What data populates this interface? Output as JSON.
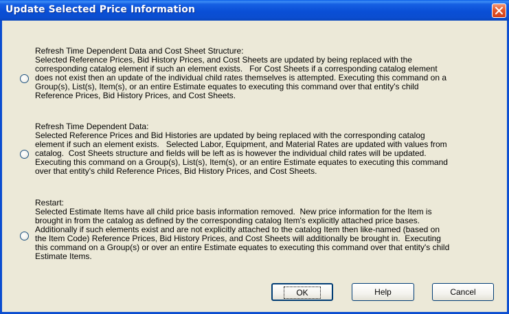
{
  "window": {
    "title": "Update Selected Price Information",
    "close_icon": "close-icon"
  },
  "options": [
    {
      "heading": "Refresh Time Dependent Data and Cost Sheet Structure:",
      "lines": [
        "Selected Reference Prices, Bid History Prices, and Cost Sheets are updated by being replaced with the",
        "corresponding catalog element if such an element exists.   For Cost Sheets if a corresponding catalog element",
        "does not exist then an update of the individual child rates themselves is attempted. Executing this command on a",
        "Group(s), List(s), Item(s), or an entire Estimate equates to executing this command over that entity's child",
        "Reference Prices, Bid History Prices, and Cost Sheets."
      ],
      "selected": false
    },
    {
      "heading": "Refresh Time Dependent Data:",
      "lines": [
        "Selected Reference Prices and Bid Histories are updated by being replaced with the corresponding catalog",
        "element if such an element exists.   Selected Labor, Equipment, and Material Rates are updated with values from",
        "catalog.  Cost Sheets structure and fields will be left as is however the individual child rates will be updated.",
        "Executing this command on a Group(s), List(s), Item(s), or an entire Estimate equates to executing this command",
        "over that entity's child Reference Prices, Bid History Prices, and Cost Sheets."
      ],
      "selected": false
    },
    {
      "heading": "Restart:",
      "lines": [
        "Selected Estimate Items have all child price basis information removed.  New price information for the Item is",
        "brought in from the catalog as defined by the corresponding catalog Item's explicitly attached price bases.",
        "Additionally if such elements exist and are not explicitly attached to the catalog Item then like-named (based on",
        "the Item Code) Reference Prices, Bid History Prices, and Cost Sheets will additionally be brought in.  Executing",
        "this command on a Group(s) or over an entire Estimate equates to executing this command over that entity's child",
        "Estimate Items."
      ],
      "selected": false
    }
  ],
  "buttons": {
    "ok": "OK",
    "help": "Help",
    "cancel": "Cancel"
  }
}
